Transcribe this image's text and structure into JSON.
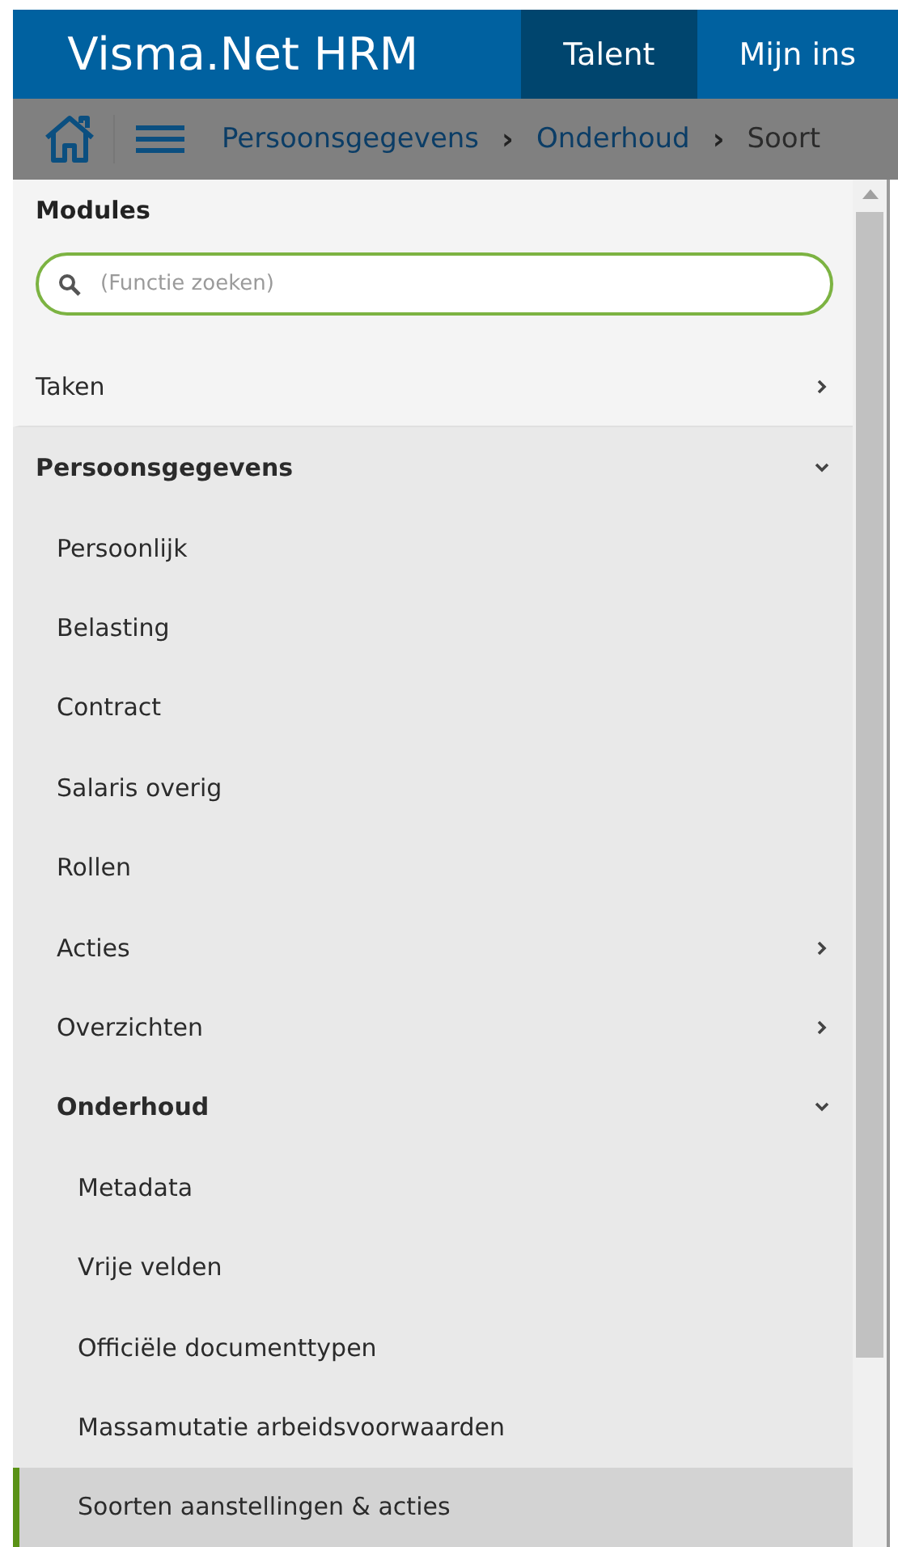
{
  "header": {
    "brand": "Visma.Net HRM",
    "tabs": [
      {
        "label": "Talent",
        "selected": true
      },
      {
        "label": "Mijn ins",
        "selected": false
      }
    ]
  },
  "breadcrumb": {
    "items": [
      "Persoonsgegevens",
      "Onderhoud",
      "Soort"
    ],
    "separator": "›"
  },
  "menu": {
    "title": "Modules",
    "search": {
      "placeholder": "(Functie zoeken)"
    },
    "items": [
      {
        "label": "Taken",
        "kind": "group",
        "expanded": false
      },
      {
        "label": "Persoonsgegevens",
        "kind": "group",
        "expanded": true,
        "children": [
          {
            "label": "Persoonlijk",
            "selected": false
          },
          {
            "label": "Belasting",
            "selected": false
          },
          {
            "label": "Contract",
            "selected": false
          },
          {
            "label": "Salaris overig",
            "selected": false
          },
          {
            "label": "Rollen",
            "selected": false
          },
          {
            "label": "Acties",
            "kind": "group",
            "expanded": false
          },
          {
            "label": "Overzichten",
            "kind": "group",
            "expanded": false
          },
          {
            "label": "Onderhoud",
            "kind": "group",
            "expanded": true,
            "children": [
              {
                "label": "Metadata",
                "selected": false
              },
              {
                "label": "Vrije velden",
                "selected": false
              },
              {
                "label": "Officiële documenttypen",
                "selected": false
              },
              {
                "label": "Massamutatie arbeidsvoorwaarden",
                "selected": false
              },
              {
                "label": "Soorten aanstellingen & acties",
                "selected": true
              }
            ]
          }
        ]
      }
    ]
  }
}
